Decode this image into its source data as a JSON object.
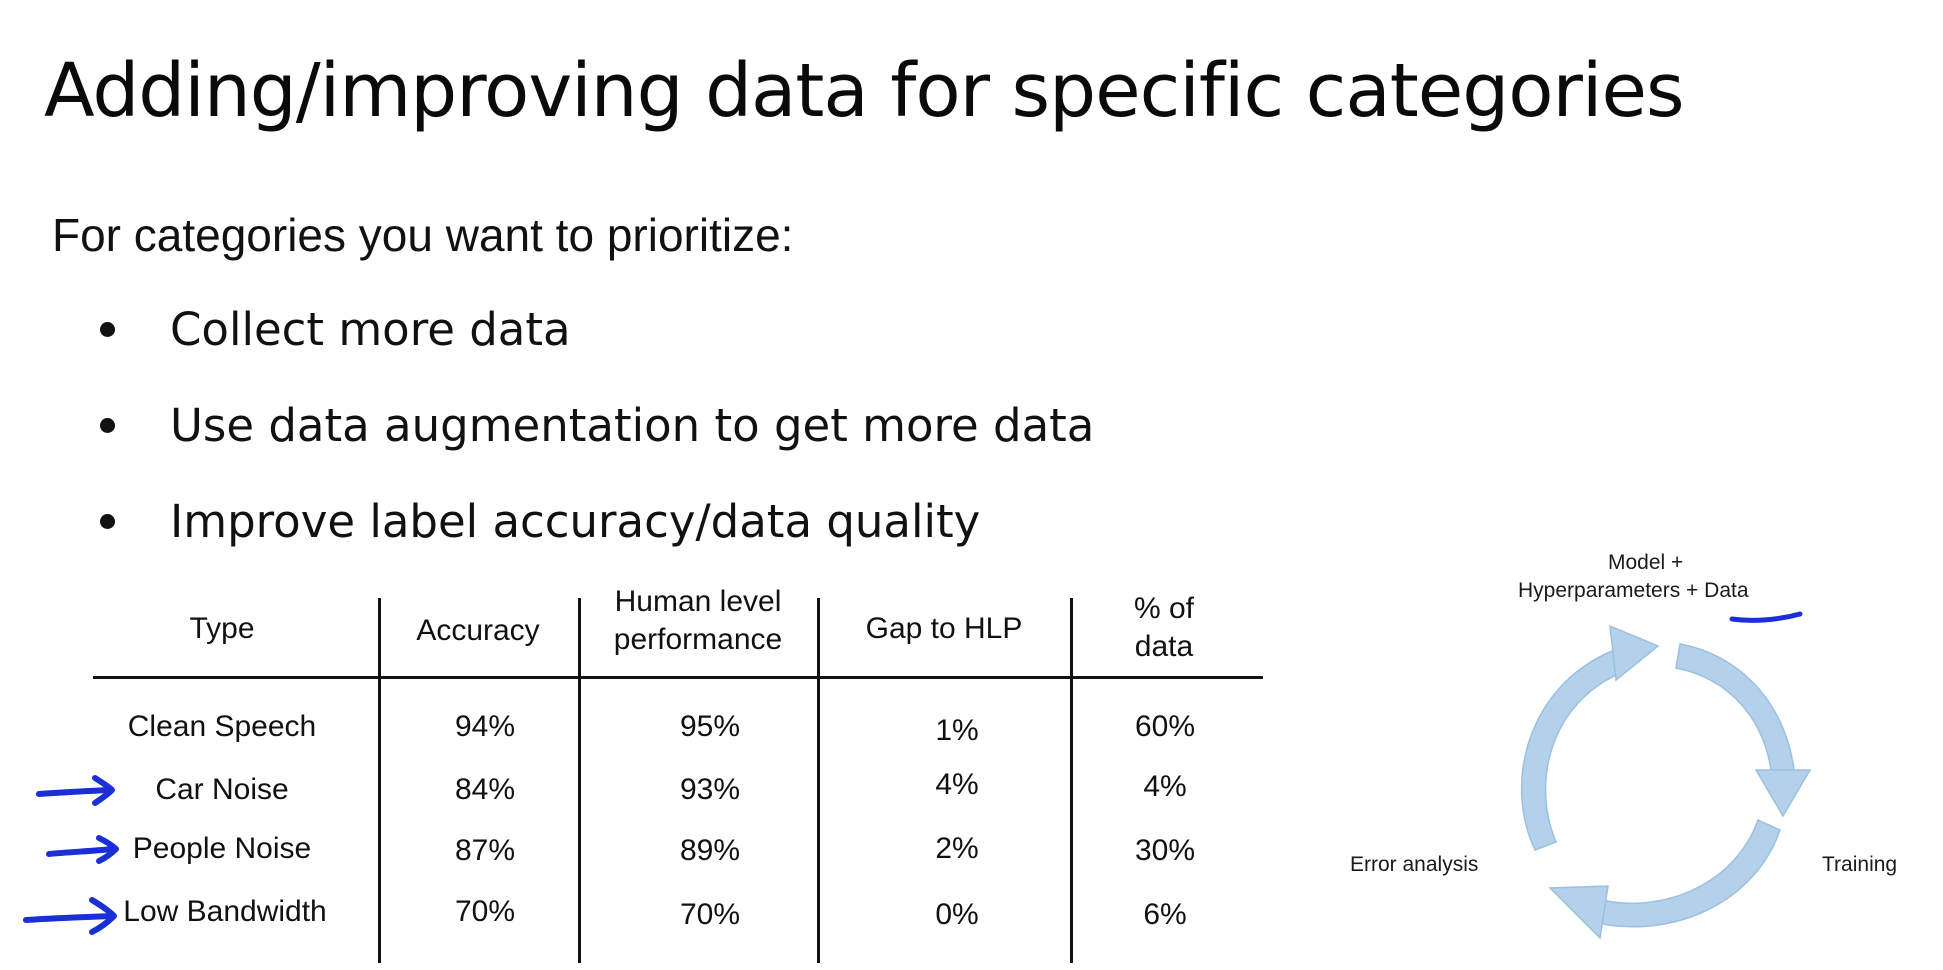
{
  "slide": {
    "title": "Adding/improving data for specific categories",
    "intro": "For categories you want to prioritize:",
    "bullets": [
      "Collect more data",
      "Use data augmentation to get more data",
      "Improve label accuracy/data quality"
    ]
  },
  "table": {
    "headers": {
      "type": "Type",
      "accuracy": "Accuracy",
      "hlp_line1": "Human level",
      "hlp_line2": "performance",
      "gap": "Gap to HLP",
      "pct_line1": "% of",
      "pct_line2": "data"
    },
    "rows": [
      {
        "type": "Clean Speech",
        "accuracy": "94%",
        "hlp": "95%",
        "gap": "1%",
        "pct": "60%",
        "marked": false
      },
      {
        "type": "Car Noise",
        "accuracy": "84%",
        "hlp": "93%",
        "gap": "4%",
        "pct": "4%",
        "marked": true
      },
      {
        "type": "People Noise",
        "accuracy": "87%",
        "hlp": "89%",
        "gap": "2%",
        "pct": "30%",
        "marked": true
      },
      {
        "type": "Low Bandwidth",
        "accuracy": "70%",
        "hlp": "70%",
        "gap": "0%",
        "pct": "6%",
        "marked": true
      }
    ]
  },
  "cycle": {
    "top_label_line1": "Model +",
    "top_label_line2": "Hyperparameters + Data",
    "left_label": "Error analysis",
    "right_label": "Training"
  },
  "colors": {
    "annotation_ink": "#1a2fd6",
    "cycle_arrow": "#b3d1ea",
    "cycle_arrow_edge": "#9cc0e0"
  },
  "icons": {
    "row_marker": "hand-drawn-arrow-icon",
    "cycle_arrows": "circular-arrows-icon"
  }
}
